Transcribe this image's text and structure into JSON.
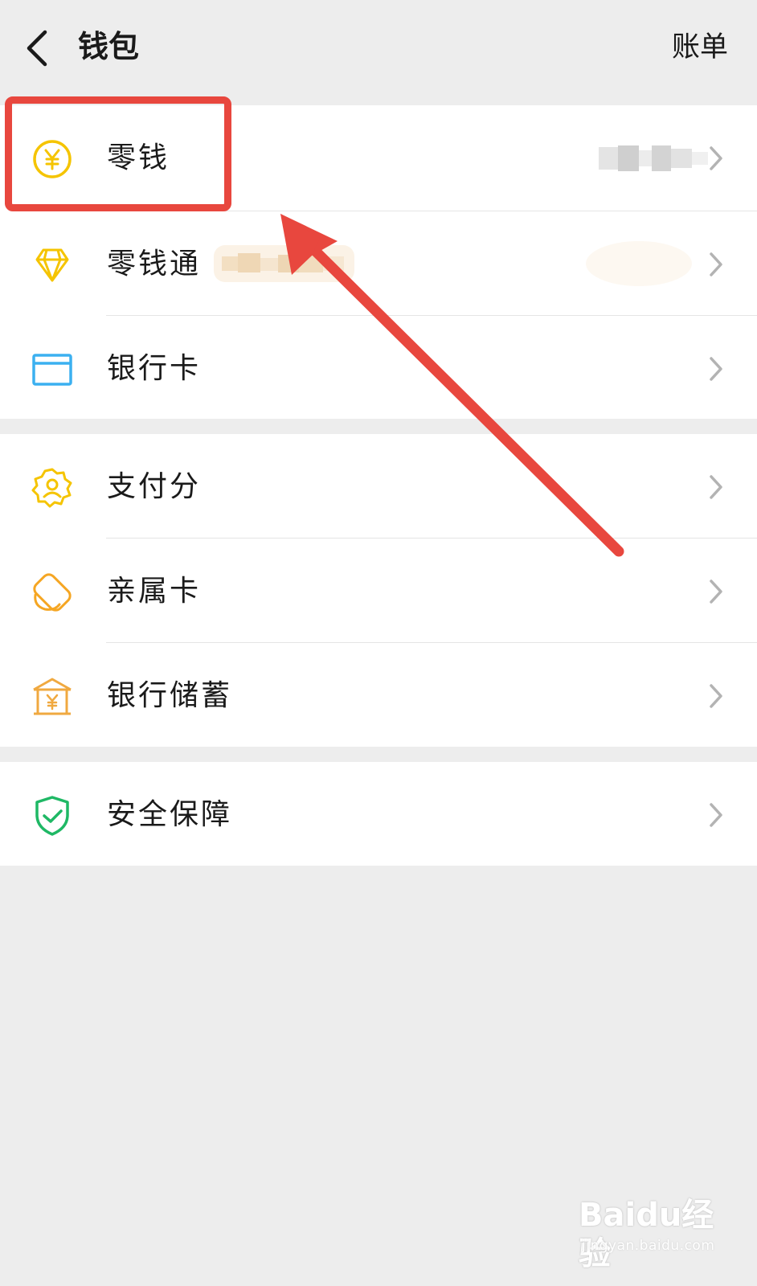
{
  "header": {
    "title": "钱包",
    "right_action": "账单",
    "back_icon": "chevron-left-icon"
  },
  "groups": [
    {
      "items": [
        {
          "label": "零钱",
          "icon": "yuan-coin-icon",
          "color": "#f5c400"
        },
        {
          "label": "零钱通",
          "icon": "diamond-icon",
          "color": "#f5c400"
        },
        {
          "label": "银行卡",
          "icon": "bank-card-icon",
          "color": "#3bb0f0"
        }
      ]
    },
    {
      "items": [
        {
          "label": "支付分",
          "icon": "score-badge-icon",
          "color": "#f5c400"
        },
        {
          "label": "亲属卡",
          "icon": "family-card-icon",
          "color": "#f5a623"
        },
        {
          "label": "银行储蓄",
          "icon": "bank-savings-icon",
          "color": "#f0a940"
        }
      ]
    },
    {
      "items": [
        {
          "label": "安全保障",
          "icon": "shield-check-icon",
          "color": "#1fb865"
        }
      ]
    }
  ],
  "annotation": {
    "highlight_color": "#e8473e",
    "highlight_target": "零钱"
  },
  "watermark": {
    "logo": "Baidu经验",
    "url": "jingyan.baidu.com"
  }
}
